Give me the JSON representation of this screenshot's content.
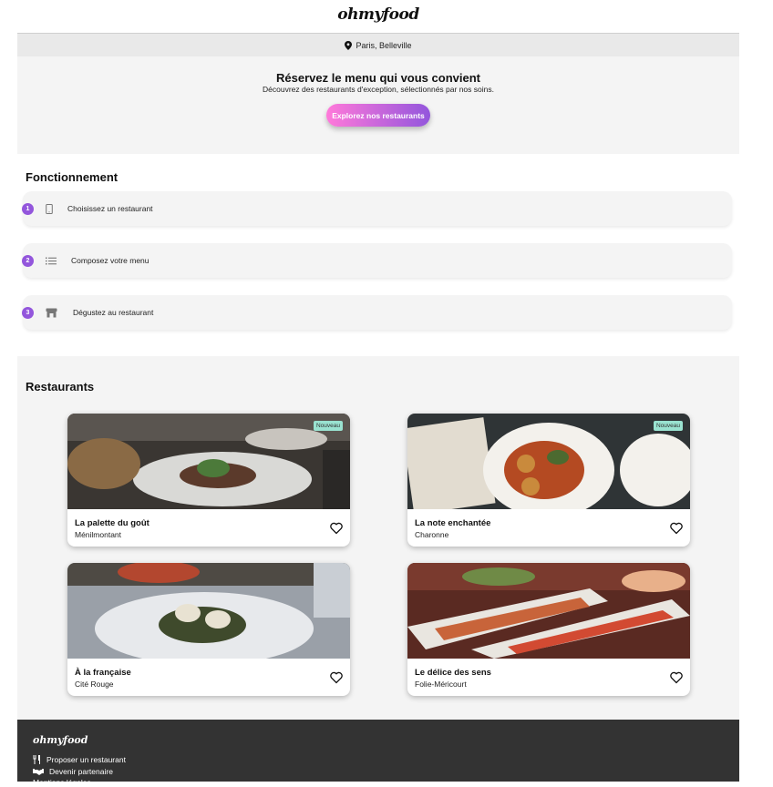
{
  "header": {
    "brand": "ohmyfood"
  },
  "location": {
    "text": "Paris, Belleville",
    "icon": "map-pin-icon"
  },
  "hero": {
    "title": "Réservez le menu qui vous convient",
    "subtitle": "Découvrez des restaurants d'exception, sélectionnés par nos soins.",
    "cta_label": "Explorez nos restaurants"
  },
  "how": {
    "title": "Fonctionnement",
    "steps": [
      {
        "number": "1",
        "label": "Choisissez un restaurant",
        "icon": "mobile-phone-icon"
      },
      {
        "number": "2",
        "label": "Composez votre menu",
        "icon": "list-icon"
      },
      {
        "number": "3",
        "label": "Dégustez au restaurant",
        "icon": "storefront-icon"
      }
    ]
  },
  "restaurants": {
    "title": "Restaurants",
    "items": [
      {
        "name": "La palette du goût",
        "area": "Ménilmontant",
        "badge": "Nouveau"
      },
      {
        "name": "La note enchantée",
        "area": "Charonne",
        "badge": "Nouveau"
      },
      {
        "name": "À la française",
        "area": "Cité Rouge",
        "badge": ""
      },
      {
        "name": "Le délice des sens",
        "area": "Folie-Méricourt",
        "badge": ""
      }
    ]
  },
  "footer": {
    "brand": "ohmyfood",
    "links": [
      {
        "label": "Proposer un restaurant",
        "icon": "utensils-icon"
      },
      {
        "label": "Devenir partenaire",
        "icon": "handshake-icon"
      },
      {
        "label": "Mentions légales",
        "icon": ""
      }
    ]
  },
  "colors": {
    "accent": "#9356dc",
    "accent_pink": "#ff79da",
    "badge": "#99e2d0",
    "footer_bg": "#333333"
  }
}
